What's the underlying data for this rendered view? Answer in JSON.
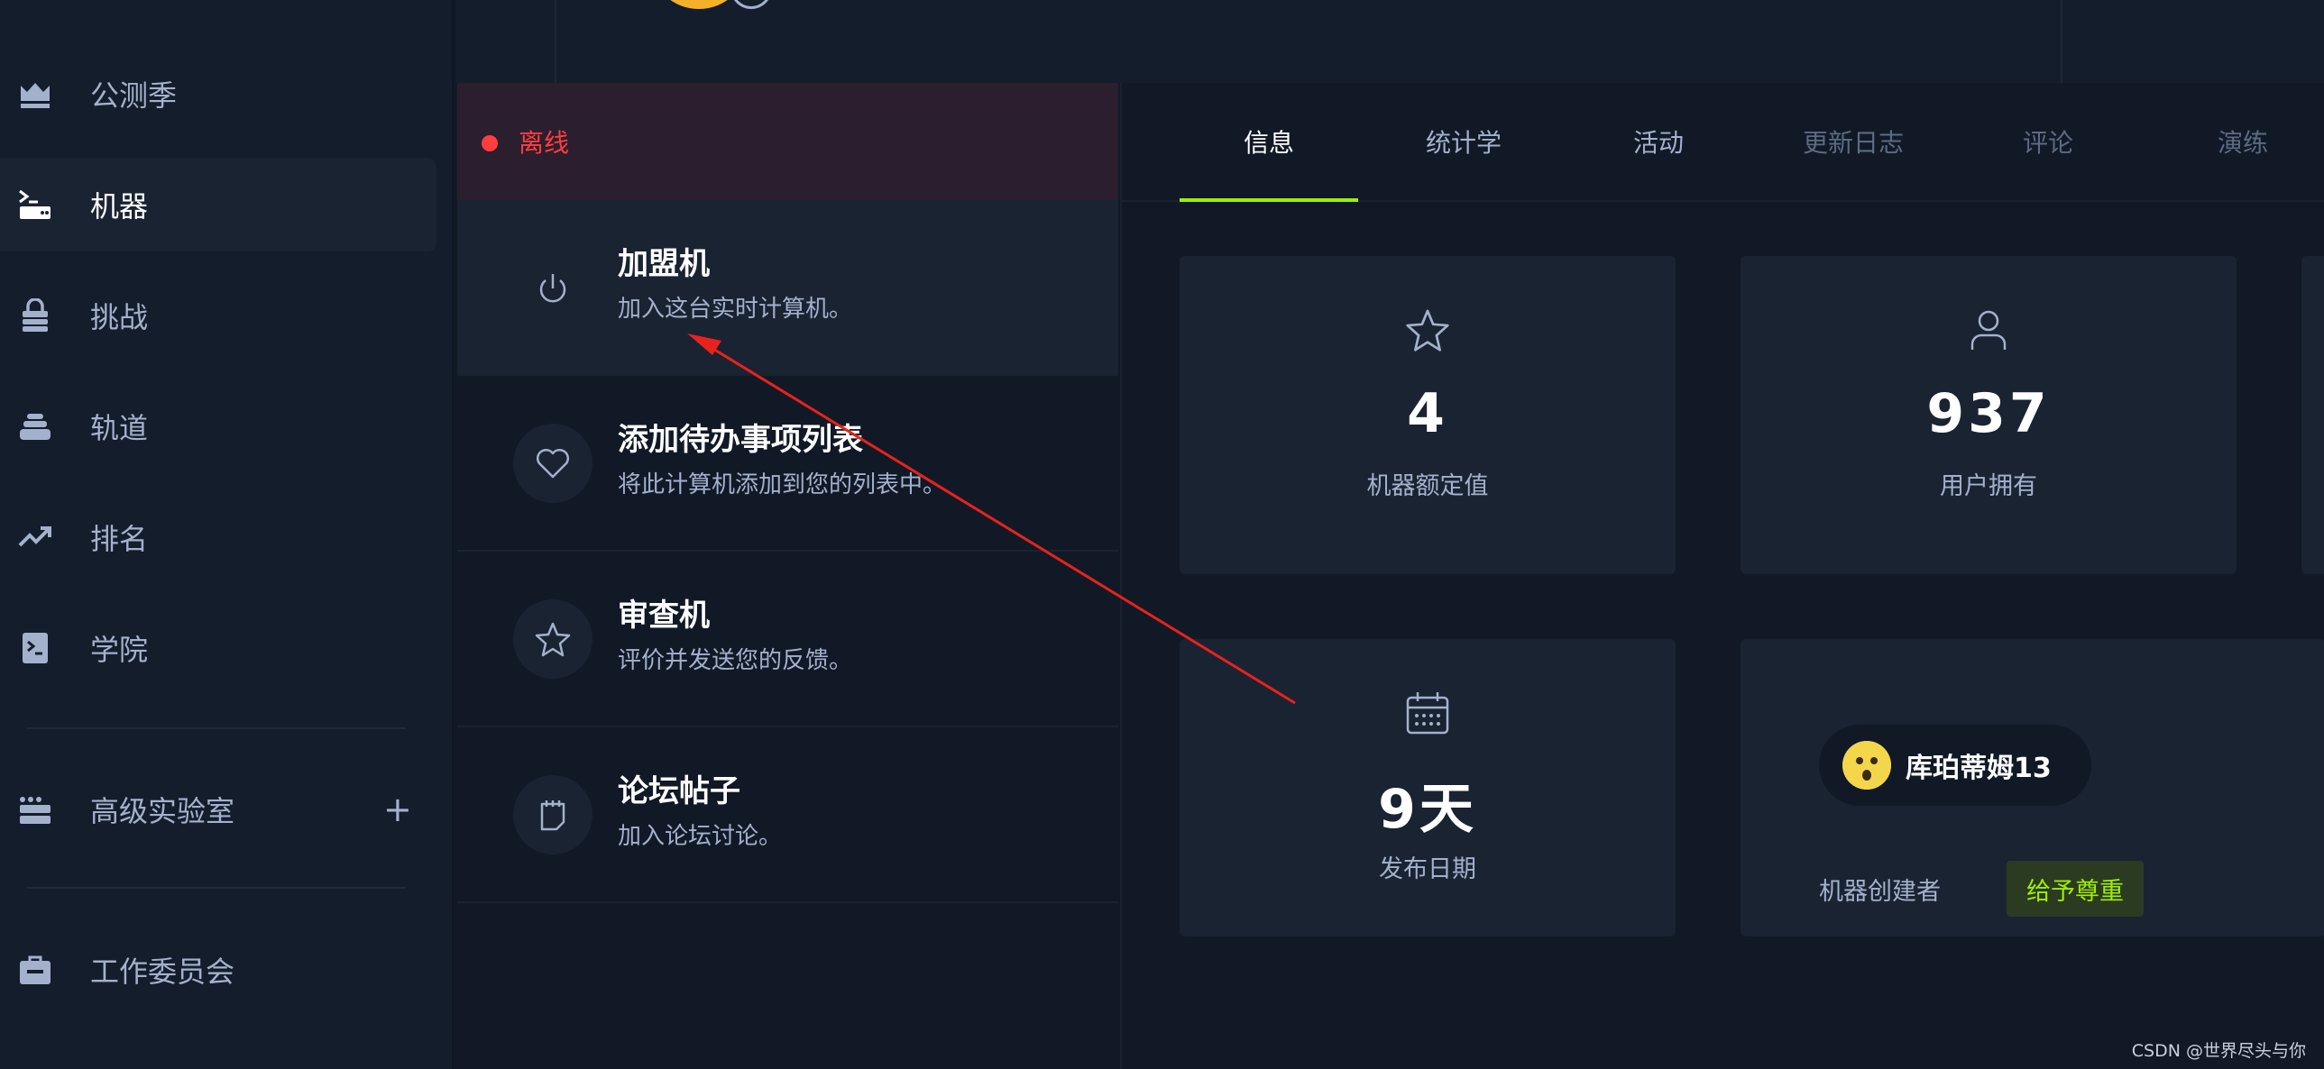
{
  "sidebar": {
    "items": [
      {
        "label": "公测季",
        "icon": "crown-icon"
      },
      {
        "label": "机器",
        "icon": "server-terminal-icon",
        "active": true
      },
      {
        "label": "挑战",
        "icon": "lock-stack-icon"
      },
      {
        "label": "轨道",
        "icon": "layers-icon"
      },
      {
        "label": "排名",
        "icon": "trending-up-icon"
      },
      {
        "label": "学院",
        "icon": "terminal-book-icon"
      }
    ],
    "pro_labs": {
      "label": "高级实验室",
      "icon": "server-rack-icon",
      "expand": "+"
    },
    "jobs": {
      "label": "工作委员会",
      "icon": "briefcase-icon"
    }
  },
  "status": {
    "text": "离线",
    "color": "#ff3e3e"
  },
  "actions": [
    {
      "title": "加盟机",
      "desc": "加入这台实时计算机。",
      "icon": "power-icon"
    },
    {
      "title": "添加待办事项列表",
      "desc": "将此计算机添加到您的列表中。",
      "icon": "heart-icon"
    },
    {
      "title": "审查机",
      "desc": "评价并发送您的反馈。",
      "icon": "star-icon"
    },
    {
      "title": "论坛帖子",
      "desc": "加入论坛讨论。",
      "icon": "notepad-icon"
    }
  ],
  "tabs": [
    "信息",
    "统计学",
    "活动",
    "更新日志",
    "评论",
    "演练"
  ],
  "stats": {
    "rating": {
      "value": "4",
      "label": "机器额定值",
      "icon": "star-icon"
    },
    "owns": {
      "value": "937",
      "label": "用户拥有",
      "icon": "user-icon"
    },
    "release": {
      "value": "9天",
      "label": "发布日期",
      "icon": "calendar-icon"
    }
  },
  "creator": {
    "name": "库珀蒂姆13",
    "role_label": "机器创建者",
    "respect_label": "给予尊重"
  },
  "watermark": "CSDN @世界尽头与你",
  "colors": {
    "accent": "#9fef00",
    "offline": "#ff3e3e",
    "background": "#111927",
    "panel": "#1a2332"
  }
}
